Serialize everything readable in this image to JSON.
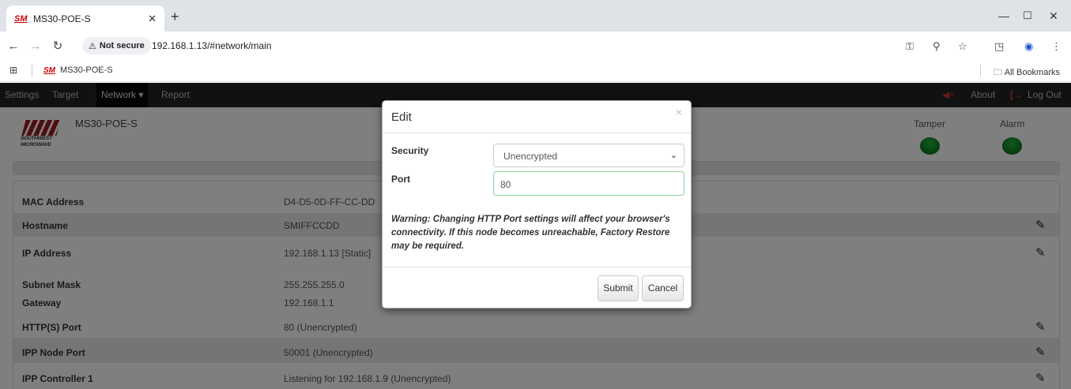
{
  "browser": {
    "tab_title": "MS30-POE-S",
    "tab_favicon": "SM",
    "new_tab": "+",
    "not_secure": "Not secure",
    "url": "192.168.1.13/#network/main",
    "bookmark_label": "MS30-POE-S",
    "all_bookmarks": "All Bookmarks"
  },
  "appnav": {
    "settings": "Settings",
    "target": "Target",
    "network": "Network ▾",
    "report": "Report",
    "about": "About",
    "logout": "Log Out"
  },
  "header": {
    "device_name": "MS30-POE-S",
    "logo_line1": "SOUTHWEST",
    "logo_line2": "MICROWAVE",
    "tamper_label": "Tamper",
    "alarm_label": "Alarm",
    "tamper_status_color": "#1a9c2e",
    "alarm_status_color": "#1a9c2e"
  },
  "rows": [
    {
      "label": "MAC Address",
      "value": "D4-D5-0D-FF-CC-DD"
    },
    {
      "label": "Hostname",
      "value": "SMIFFCCDD"
    },
    {
      "label": "IP Address",
      "value": "192.168.1.13 [Static]"
    },
    {
      "label": "Subnet Mask",
      "value": "255.255.255.0"
    },
    {
      "label": "Gateway",
      "value": "192.168.1.1"
    },
    {
      "label": "HTTP(S) Port",
      "value": "80 (Unencrypted)"
    },
    {
      "label": "IPP Node Port",
      "value": "50001 (Unencrypted)"
    },
    {
      "label": "IPP Controller 1",
      "value": "Listening for 192.168.1.9 (Unencrypted)"
    }
  ],
  "modal": {
    "title": "Edit",
    "close": "×",
    "security_label": "Security",
    "security_value": "Unencrypted",
    "port_label": "Port",
    "port_value": "80",
    "warning": "Warning: Changing HTTP Port settings will affect your browser's connectivity. If this node becomes unreachable, Factory Restore may be required.",
    "submit": "Submit",
    "cancel": "Cancel"
  }
}
